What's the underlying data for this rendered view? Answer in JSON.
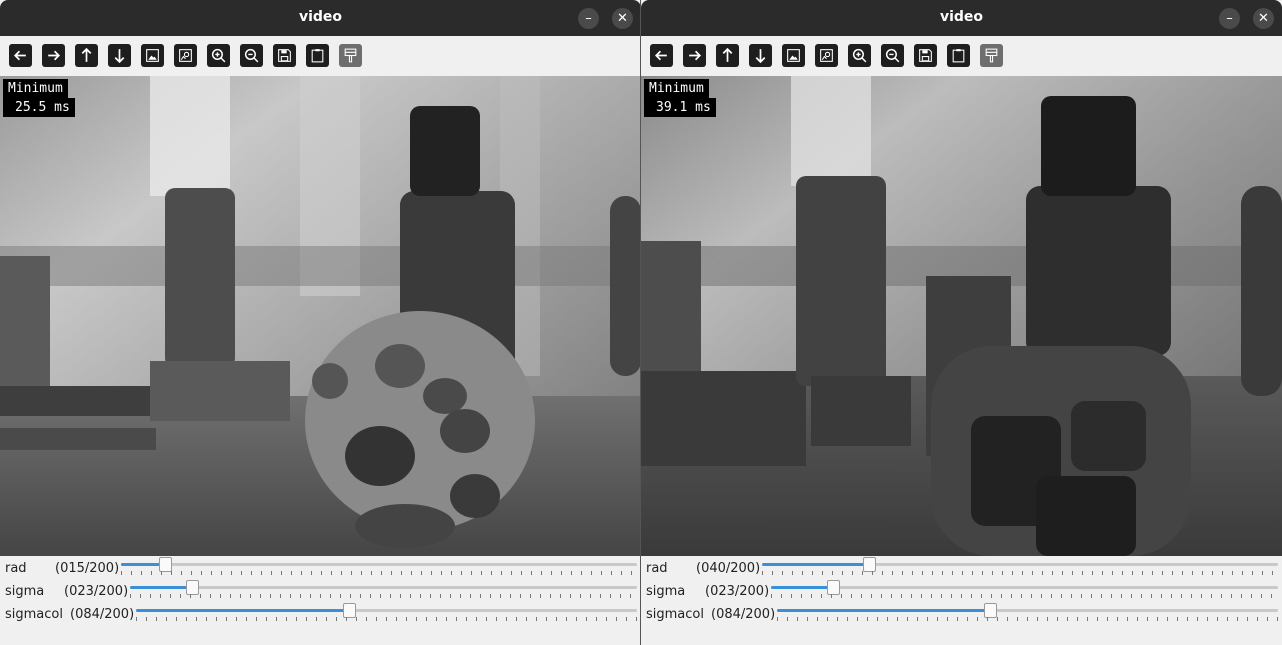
{
  "windows": [
    {
      "title": "video",
      "overlay": {
        "line1": "Minimum",
        "line2": "25.5 ms"
      },
      "toolbar": [
        "arrow-left-icon",
        "arrow-right-icon",
        "arrow-up-icon",
        "arrow-down-icon",
        "image-icon",
        "image-settings-icon",
        "zoom-in-icon",
        "zoom-out-icon",
        "save-icon",
        "clipboard-icon",
        "paint-icon"
      ],
      "sliders": [
        {
          "label": "rad",
          "value": "(015/200)",
          "fraction": 0.075
        },
        {
          "label": "sigma",
          "value": "(023/200)",
          "fraction": 0.115
        },
        {
          "label": "sigmacol",
          "value": "(084/200)",
          "fraction": 0.42
        }
      ]
    },
    {
      "title": "video",
      "overlay": {
        "line1": "Minimum",
        "line2": "39.1 ms"
      },
      "toolbar": [
        "arrow-left-icon",
        "arrow-right-icon",
        "arrow-up-icon",
        "arrow-down-icon",
        "image-icon",
        "image-settings-icon",
        "zoom-in-icon",
        "zoom-out-icon",
        "save-icon",
        "clipboard-icon",
        "paint-icon"
      ],
      "sliders": [
        {
          "label": "rad",
          "value": "(040/200)",
          "fraction": 0.2
        },
        {
          "label": "sigma",
          "value": "(023/200)",
          "fraction": 0.115
        },
        {
          "label": "sigmacol",
          "value": "(084/200)",
          "fraction": 0.42
        }
      ]
    }
  ],
  "window_buttons": {
    "minimize": "–",
    "close": "✕"
  }
}
